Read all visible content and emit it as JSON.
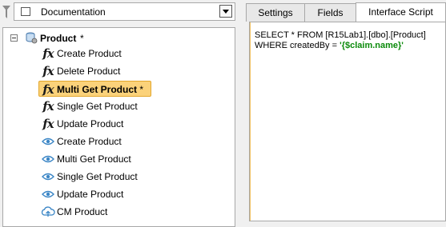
{
  "filter": {
    "icon": "funnel-icon",
    "dropdown_value": "Documentation"
  },
  "tree": {
    "root": {
      "label": "Product",
      "modified_marker": "*",
      "icon": "database-icon"
    },
    "items": [
      {
        "label": "Create Product",
        "icon": "fx-icon"
      },
      {
        "label": "Delete Product",
        "icon": "fx-icon"
      },
      {
        "label": "Multi Get Product",
        "icon": "fx-icon",
        "selected": true,
        "modified_marker": "*"
      },
      {
        "label": "Single Get Product",
        "icon": "fx-icon"
      },
      {
        "label": "Update Product",
        "icon": "fx-icon"
      },
      {
        "label": "Create Product",
        "icon": "eye-icon"
      },
      {
        "label": "Multi Get Product",
        "icon": "eye-icon"
      },
      {
        "label": "Single Get Product",
        "icon": "eye-icon"
      },
      {
        "label": "Update Product",
        "icon": "eye-icon"
      },
      {
        "label": "CM Product",
        "icon": "cloud-upload-icon"
      }
    ]
  },
  "tabs": [
    {
      "label": "Settings"
    },
    {
      "label": "Fields"
    },
    {
      "label": "Interface Script",
      "active": true
    }
  ],
  "script": {
    "line1": "SELECT * FROM [R15Lab1].[dbo].[Product]",
    "line2_prefix": "WHERE createdBy = ",
    "line2_string": "'{$claim.name}'"
  },
  "colors": {
    "selection_fill": "#fbd27a",
    "selection_border": "#e3a72c",
    "string_literal": "#0a8a0a",
    "eye_icon": "#3b86c6"
  }
}
